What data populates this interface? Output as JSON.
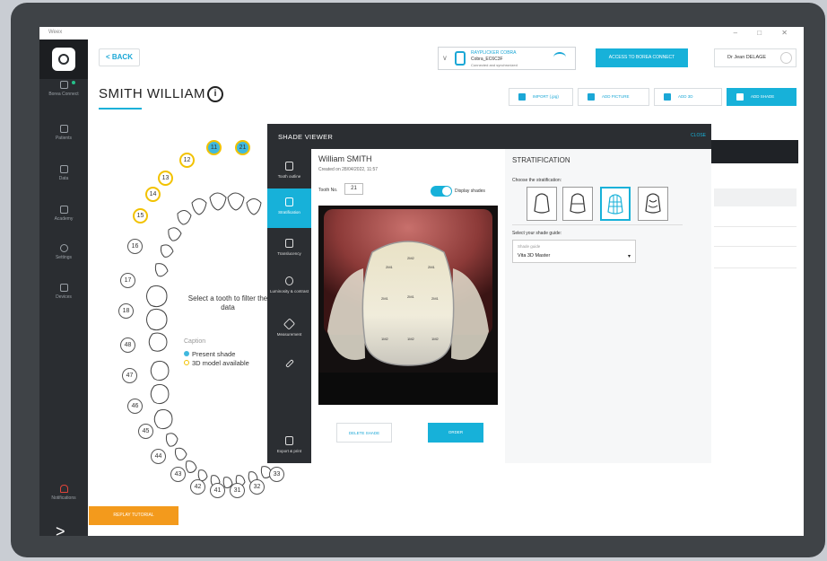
{
  "window": {
    "app_title": "Weex",
    "controls": [
      "–",
      "□",
      "✕"
    ]
  },
  "sidebar": {
    "items": [
      {
        "label": "Borea Connect",
        "icon": "connect-icon"
      },
      {
        "label": "Patients",
        "icon": "patients-icon"
      },
      {
        "label": "Data",
        "icon": "data-icon"
      },
      {
        "label": "Academy",
        "icon": "academy-icon"
      },
      {
        "label": "Settings",
        "icon": "settings-icon"
      },
      {
        "label": "Devices",
        "icon": "devices-icon"
      },
      {
        "label": "Notifications",
        "icon": "bell-icon"
      }
    ],
    "expand_glyph": ">"
  },
  "header": {
    "back_label": "< BACK",
    "device": {
      "name": "RAYPLICKER COBRA",
      "serial": "Cobra_EC6C3F",
      "status": "Connected and synchronized"
    },
    "access_label": "ACCESS TO BOREA CONNECT",
    "user_label": "Dr Jean DELAGE"
  },
  "patient": {
    "name": "SMITH WILLIAM",
    "info_glyph": "i"
  },
  "toolbar": {
    "import_label": "IMPORT (.jpg)",
    "add_picture_label": "ADD PICTURE",
    "add_3d_label": "ADD 3D",
    "add_shade_label": "ADD SHADE"
  },
  "tooth_chart": {
    "hint": "Select a tooth to filter the data",
    "caption_title": "Caption",
    "legend": [
      {
        "label": "Present shade",
        "color": "#3fb8de"
      },
      {
        "label": "3D model available",
        "color": "#f2c200"
      }
    ],
    "teeth": [
      {
        "num": "11",
        "state": "present"
      },
      {
        "num": "21",
        "state": "present"
      },
      {
        "num": "12",
        "state": "model"
      },
      {
        "num": "13",
        "state": "model"
      },
      {
        "num": "14",
        "state": "model"
      },
      {
        "num": "15",
        "state": "model"
      },
      {
        "num": "16",
        "state": "none"
      },
      {
        "num": "17",
        "state": "none"
      },
      {
        "num": "18",
        "state": "none"
      },
      {
        "num": "48",
        "state": "none"
      },
      {
        "num": "47",
        "state": "none"
      },
      {
        "num": "46",
        "state": "none"
      },
      {
        "num": "45",
        "state": "none"
      },
      {
        "num": "44",
        "state": "none"
      },
      {
        "num": "43",
        "state": "none"
      },
      {
        "num": "42",
        "state": "none"
      },
      {
        "num": "41",
        "state": "none"
      },
      {
        "num": "31",
        "state": "none"
      },
      {
        "num": "32",
        "state": "none"
      },
      {
        "num": "33",
        "state": "none"
      }
    ]
  },
  "replay_label": "REPLAY TUTORIAL",
  "shade_viewer": {
    "title": "SHADE VIEWER",
    "close_label": "CLOSE",
    "tools": [
      {
        "label": "Tooth outline",
        "icon": "tooth-outline-icon"
      },
      {
        "label": "Stratification",
        "icon": "stratification-icon"
      },
      {
        "label": "Translucency",
        "icon": "translucency-icon"
      },
      {
        "label": "Luminosity & contrast",
        "icon": "luminosity-icon"
      },
      {
        "label": "Measurement",
        "icon": "ruler-icon"
      },
      {
        "label": "",
        "icon": "pen-icon"
      },
      {
        "label": "Export & print",
        "icon": "export-icon"
      }
    ],
    "patient_name": "William SMITH",
    "created": "Created on 28/04/2022, 11:57",
    "tooth_no_label": "Tooth No.",
    "tooth_no_value": "21",
    "display_shades_label": "Display shades",
    "delete_label": "DELETE SHADE",
    "order_label": "ORDER",
    "stratification": {
      "title": "STRATIFICATION",
      "choose_label": "Choose the stratification:",
      "selected_index": 2,
      "guide_label": "Select your shade guide:",
      "guide_placeholder": "Shade guide",
      "guide_value": "Vita 3D Master"
    }
  }
}
